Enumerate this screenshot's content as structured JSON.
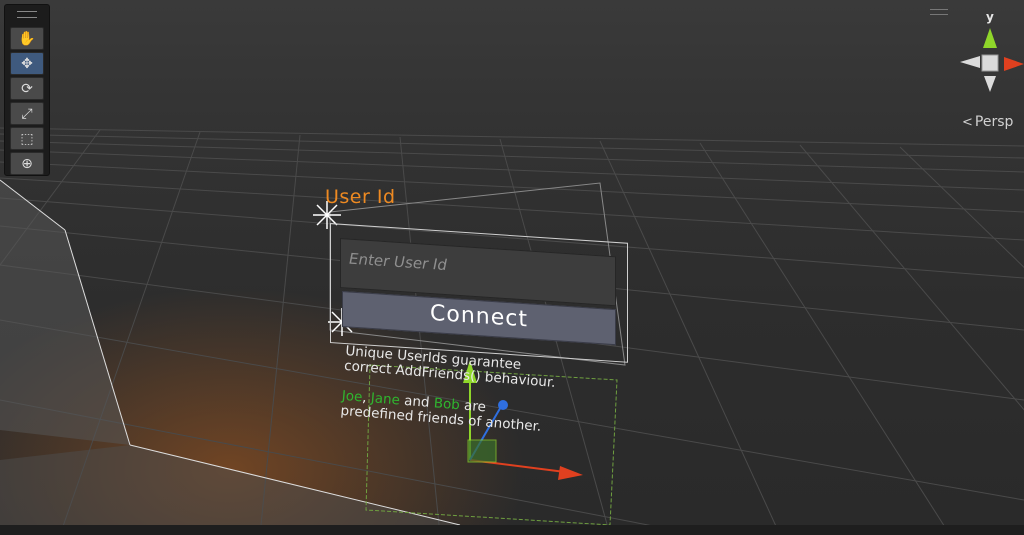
{
  "toolbar": {
    "tools": [
      {
        "name": "hand-tool",
        "icon": "hand-icon",
        "glyph": "✋",
        "active": false
      },
      {
        "name": "move-tool",
        "icon": "move-arrows-icon",
        "glyph": "✥",
        "active": true
      },
      {
        "name": "rotate-tool",
        "icon": "rotate-icon",
        "glyph": "⟳",
        "active": false
      },
      {
        "name": "scale-tool",
        "icon": "scale-icon",
        "glyph": "⤢",
        "active": false
      },
      {
        "name": "rect-tool",
        "icon": "rect-transform-icon",
        "glyph": "⬚",
        "active": false
      },
      {
        "name": "transform-tool",
        "icon": "transform-icon",
        "glyph": "⊕",
        "active": false
      }
    ]
  },
  "scene": {
    "userid_label": "User Id",
    "input_placeholder": "Enter User Id",
    "connect_label": "Connect",
    "info_line1": "Unique UserIds guarantee",
    "info_line2": "correct AddFriends() behaviour.",
    "friend1": "Joe",
    "sep1": ", ",
    "friend2": "Jane",
    "and": " and ",
    "friend3": "Bob",
    "are": " are",
    "info_line4": "predefined friends of another."
  },
  "gizmo": {
    "axis_y_label": "y",
    "view_label": "Persp",
    "chevron": "<"
  },
  "colors": {
    "accent_orange": "#ee8a22",
    "friend_green": "#2fb52f",
    "axis_x": "#e0401f",
    "axis_y": "#8fd62a",
    "axis_z": "#2f6fe0",
    "active_tool": "#3f5a7e"
  }
}
